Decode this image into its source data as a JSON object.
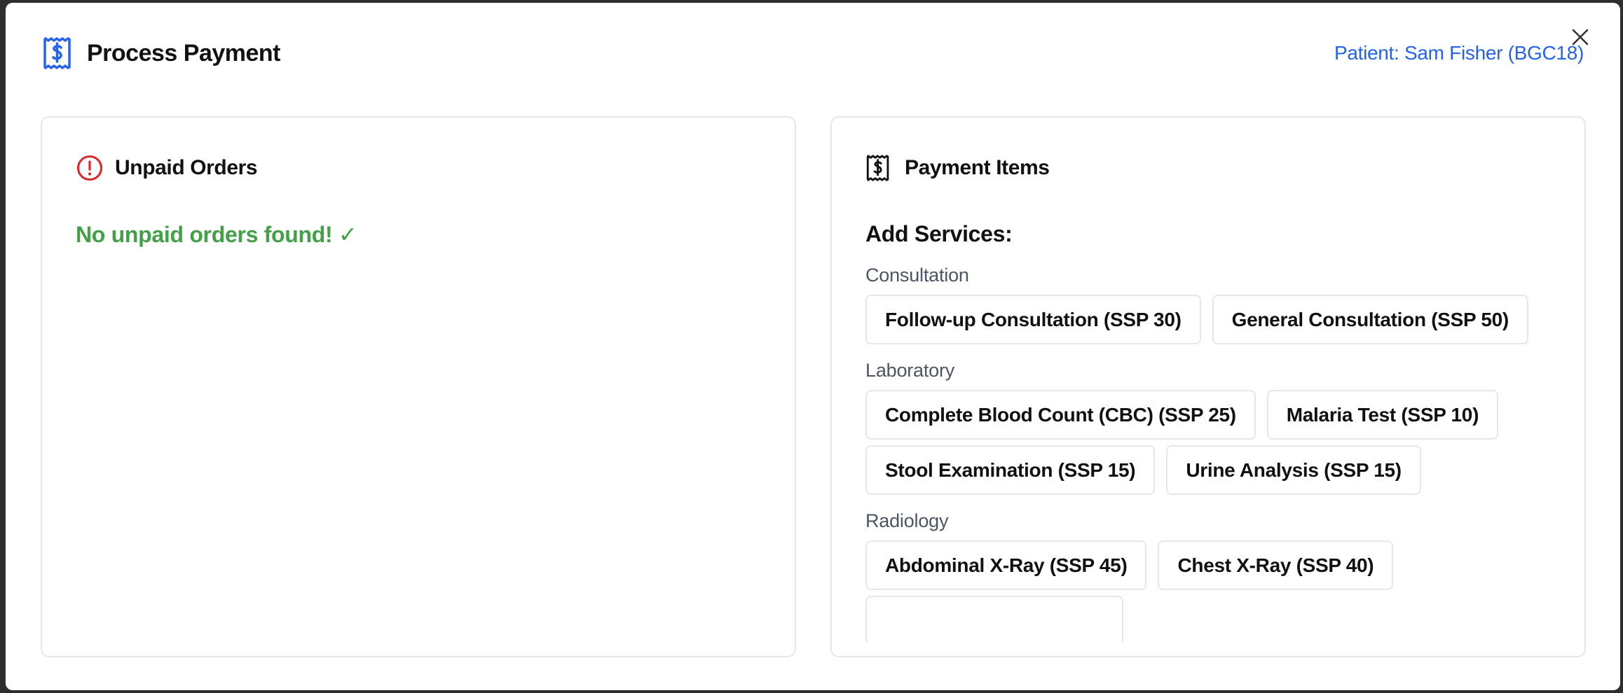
{
  "modal": {
    "title": "Process Payment",
    "patient": "Patient: Sam Fisher (BGC18)",
    "close_icon": "close-icon",
    "title_icon": "receipt-dollar-icon"
  },
  "unpaid": {
    "heading": "Unpaid Orders",
    "icon": "alert-circle-icon",
    "message": "No unpaid orders found! ✓"
  },
  "payment": {
    "heading": "Payment Items",
    "icon": "receipt-dollar-icon",
    "add_services_label": "Add Services:",
    "categories": [
      {
        "name": "Consultation",
        "rows": [
          [
            "Follow-up Consultation (SSP 30)",
            "General Consultation (SSP 50)"
          ]
        ]
      },
      {
        "name": "Laboratory",
        "rows": [
          [
            "Complete Blood Count (CBC) (SSP 25)",
            "Malaria Test (SSP 10)"
          ],
          [
            "Stool Examination (SSP 15)",
            "Urine Analysis (SSP 15)"
          ]
        ]
      },
      {
        "name": "Radiology",
        "rows": [
          [
            "Abdominal X-Ray (SSP 45)",
            "Chest X-Ray (SSP 40)"
          ]
        ]
      }
    ]
  },
  "colors": {
    "accent": "#2563eb",
    "success": "#43a047",
    "alert": "#dc2626"
  }
}
